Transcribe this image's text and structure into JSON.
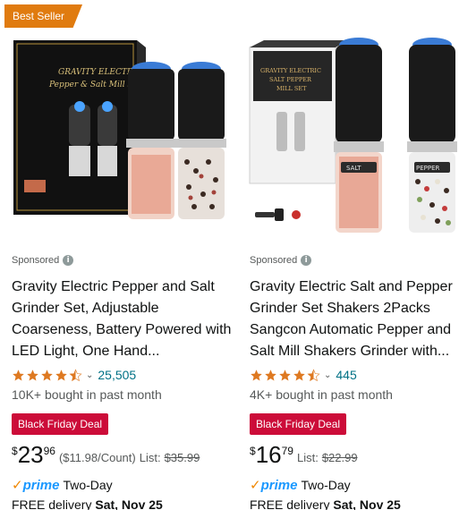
{
  "products": [
    {
      "badge": "Best Seller",
      "box_text_line1": "GRAVITY ELECTRIC",
      "box_text_line2": "Pepper & Salt Mill Set",
      "sponsored": "Sponsored",
      "title": "Gravity Electric Pepper and Salt Grinder Set, Adjustable Coarseness, Battery Powered with LED Light, One Hand...",
      "rating": 4.5,
      "reviews": "25,505",
      "bought": "10K+ bought in past month",
      "deal": "Black Friday Deal",
      "price_symbol": "$",
      "price_whole": "23",
      "price_fraction": "96",
      "unit_price": "($11.98/Count)",
      "list_label": "List:",
      "list_price": "$35.99",
      "prime": "prime",
      "prime_speed": "Two-Day",
      "delivery_label": "FREE delivery",
      "delivery_date": "Sat, Nov 25"
    },
    {
      "badge": "",
      "box_text_line1": "GRAVITY ELECTRIC",
      "box_text_line2": "SALT PEPPER",
      "box_text_line3": "MILL SET",
      "salt_label": "SALT",
      "pepper_label": "PEPPER",
      "sponsored": "Sponsored",
      "title": "Gravity Electric Salt and Pepper Grinder Set Shakers 2Packs Sangcon Automatic Pepper and Salt Mill Shakers Grinder with...",
      "rating": 4.5,
      "reviews": "445",
      "bought": "4K+ bought in past month",
      "deal": "Black Friday Deal",
      "price_symbol": "$",
      "price_whole": "16",
      "price_fraction": "79",
      "unit_price": "",
      "list_label": "List:",
      "list_price": "$22.99",
      "prime": "prime",
      "prime_speed": "Two-Day",
      "delivery_label": "FREE delivery",
      "delivery_date": "Sat, Nov 25"
    }
  ],
  "icons": {
    "info": "info-icon",
    "star": "star-icon",
    "chevron": "chevron-down-icon",
    "prime": "prime-check-icon"
  },
  "colors": {
    "badge": "#e07b0f",
    "deal": "#cc0c39",
    "star": "#de7921",
    "link": "#007185",
    "prime": "#1a98ff"
  }
}
